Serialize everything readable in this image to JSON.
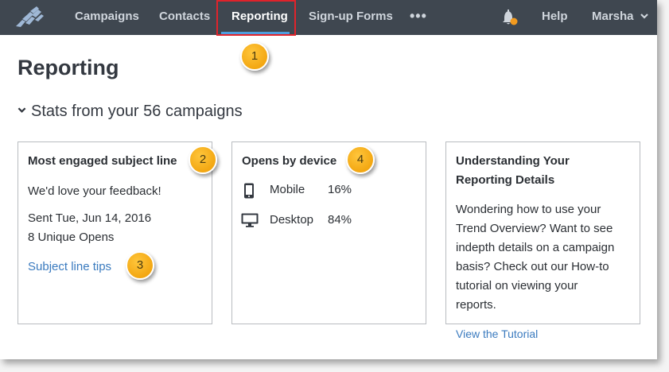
{
  "nav": {
    "items": [
      "Campaigns",
      "Contacts",
      "Reporting",
      "Sign-up Forms"
    ],
    "more": "•••",
    "help": "Help",
    "user": "Marsha",
    "active": "Reporting",
    "accent": "#4f9ede",
    "notification_color": "#f29a1e"
  },
  "page": {
    "title": "Reporting",
    "stats_heading": "Stats from your 56 campaigns"
  },
  "cards": {
    "subject": {
      "title": "Most engaged subject line",
      "subject_line": "We'd love your feedback!",
      "sent": "Sent Tue, Jun 14, 2016",
      "opens": "8 Unique Opens",
      "link": "Subject line tips"
    },
    "device": {
      "title": "Opens by device",
      "rows": [
        {
          "label": "Mobile",
          "value": "16%",
          "icon": "mobile-phone-icon"
        },
        {
          "label": "Desktop",
          "value": "84%",
          "icon": "desktop-monitor-icon"
        }
      ]
    },
    "help": {
      "title_line1": "Understanding Your",
      "title_line2": "Reporting Details",
      "body_lines": [
        "Wondering how to use your",
        "Trend Overview? Want to see",
        "indepth details on a campaign",
        "basis? Check out our How-to",
        "tutorial on viewing your",
        "reports."
      ],
      "link": "View the Tutorial"
    }
  },
  "callouts": [
    "1",
    "2",
    "3",
    "4"
  ],
  "colors": {
    "callout": "#f3a712",
    "highlight_border": "#e0232b",
    "link": "#3b7bbf",
    "nav_bg": "#3f4750"
  }
}
